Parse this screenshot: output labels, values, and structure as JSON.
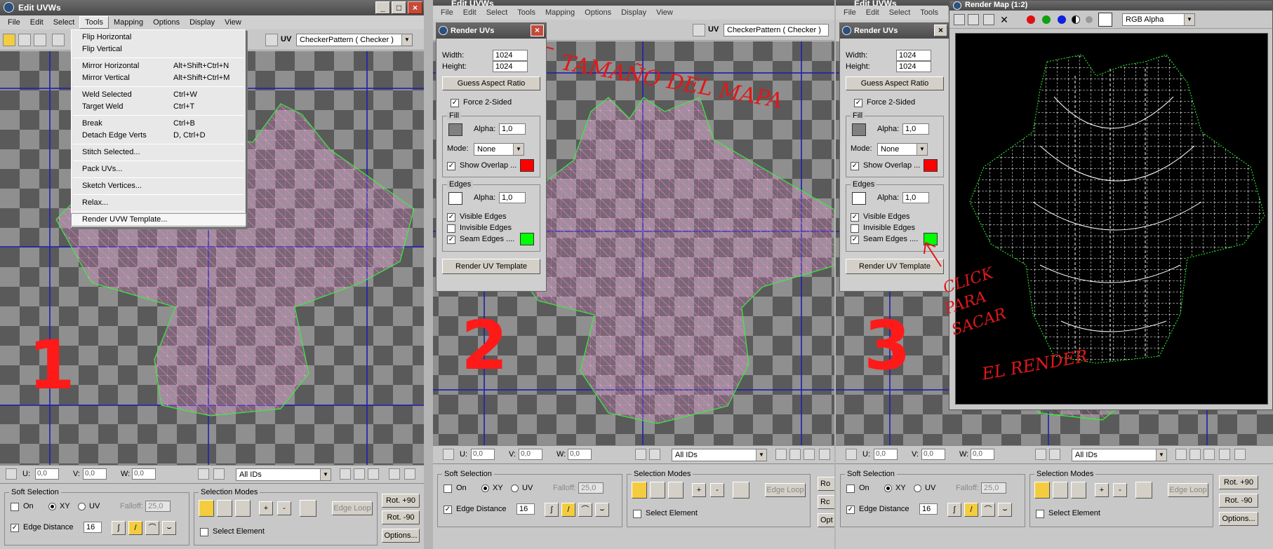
{
  "panel1": {
    "title": "Edit UVWs",
    "menu": [
      "File",
      "Edit",
      "Select",
      "Tools",
      "Mapping",
      "Options",
      "Display",
      "View"
    ],
    "uv_label": "UV",
    "texture_dropdown": "CheckerPattern  ( Checker )",
    "tools_menu": [
      {
        "label": "Flip Horizontal",
        "shortcut": ""
      },
      {
        "label": "Flip Vertical",
        "shortcut": ""
      },
      {
        "label": "Mirror Horizontal",
        "shortcut": "Alt+Shift+Ctrl+N"
      },
      {
        "label": "Mirror Vertical",
        "shortcut": "Alt+Shift+Ctrl+M"
      },
      {
        "label": "Weld Selected",
        "shortcut": "Ctrl+W"
      },
      {
        "label": "Target Weld",
        "shortcut": "Ctrl+T"
      },
      {
        "label": "Break",
        "shortcut": "Ctrl+B"
      },
      {
        "label": "Detach Edge Verts",
        "shortcut": "D, Ctrl+D"
      },
      {
        "label": "Stitch Selected...",
        "shortcut": ""
      },
      {
        "label": "Pack UVs...",
        "shortcut": ""
      },
      {
        "label": "Sketch Vertices...",
        "shortcut": ""
      },
      {
        "label": "Relax...",
        "shortcut": ""
      },
      {
        "label": "Render UVW Template...",
        "shortcut": ""
      }
    ],
    "step_number": "1"
  },
  "panel2": {
    "title": "Edit UVWs",
    "menu": [
      "File",
      "Edit",
      "Select",
      "Tools",
      "Mapping",
      "Options",
      "Display",
      "View"
    ],
    "uv_label": "UV",
    "texture_dropdown": "CheckerPattern  ( Checker )",
    "step_number": "2",
    "annotation": "TAMAÑO DEL MAPA"
  },
  "panel3": {
    "title": "Edit UVWs",
    "menu": [
      "File",
      "Edit",
      "Select",
      "Tools",
      "Ma"
    ],
    "step_number": "3",
    "annotation_lines": [
      "CLICK",
      "PARA",
      "SACAR",
      "EL RENDER"
    ]
  },
  "render_uvs": {
    "title": "Render UVs",
    "width_label": "Width:",
    "width_value": "1024",
    "height_label": "Height:",
    "height_value": "1024",
    "guess_aspect": "Guess Aspect Ratio",
    "force_2sided": "Force 2-Sided",
    "fill_group": "Fill",
    "alpha_label": "Alpha:",
    "fill_alpha": "1,0",
    "mode_label": "Mode:",
    "mode_value": "None",
    "show_overlap": "Show Overlap ...",
    "edges_group": "Edges",
    "edges_alpha": "1,0",
    "visible_edges": "Visible Edges",
    "invisible_edges": "Invisible Edges",
    "seam_edges": "Seam Edges ....",
    "render_button": "Render UV Template",
    "colors": {
      "overlap": "#ff0000",
      "seam": "#00ff00",
      "fill_swatch_2": "#808080",
      "fill_swatch_3": "#808080",
      "edge_swatch": "#ffffff"
    }
  },
  "statusbar": {
    "u_label": "U:",
    "v_label": "V:",
    "w_label": "W:",
    "u_value": "0,0",
    "v_value": "0,0",
    "w_value": "0,0",
    "ids_dropdown": "All IDs"
  },
  "soft_selection": {
    "title": "Soft Selection",
    "on": "On",
    "xy": "XY",
    "uv": "UV",
    "falloff_label": "Falloff:",
    "falloff_value": "25,0",
    "edge_distance": "Edge Distance",
    "edge_distance_value": "16"
  },
  "selection_modes": {
    "title": "Selection Modes",
    "plus": "+",
    "minus": "-",
    "edge_loop": "Edge Loop",
    "select_element": "Select Element"
  },
  "right_buttons": {
    "rot_plus": "Rot. +90",
    "rot_minus": "Rot. -90",
    "options": "Options...",
    "rot_plus_short": "Ro",
    "rot_minus_short": "Rc",
    "options_short": "Opt"
  },
  "render_map": {
    "title": "Render Map (1:2)",
    "channel_dropdown": "RGB Alpha",
    "colors": {
      "wire": "#ffffff",
      "seam": "#00ff00",
      "background": "#000000"
    }
  },
  "menu_highlight_index": 3
}
